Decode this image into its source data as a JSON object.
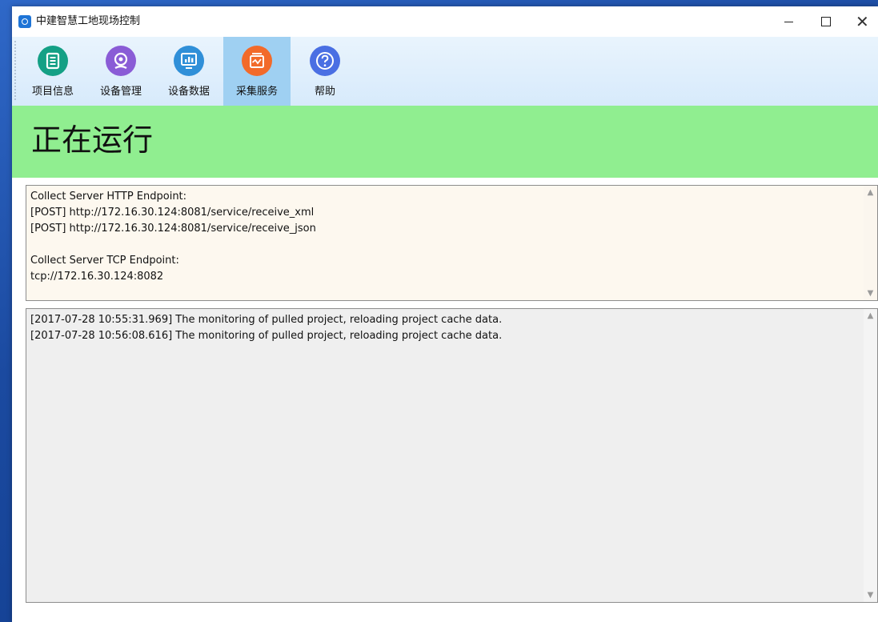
{
  "window": {
    "title": "中建智慧工地现场控制",
    "controls": {
      "minimize": "minimize-icon",
      "maximize": "maximize-icon",
      "close": "close-icon"
    }
  },
  "toolbar": {
    "items": [
      {
        "label": "项目信息",
        "icon": "document-icon",
        "color": "#14a085",
        "active": false
      },
      {
        "label": "设备管理",
        "icon": "webcam-icon",
        "color": "#8a5cd6",
        "active": false
      },
      {
        "label": "设备数据",
        "icon": "monitor-chart-icon",
        "color": "#2f8fd8",
        "active": false
      },
      {
        "label": "采集服务",
        "icon": "collection-service-icon",
        "color": "#f26a2a",
        "active": true
      },
      {
        "label": "帮助",
        "icon": "help-icon",
        "color": "#4a6fe3",
        "active": false
      }
    ]
  },
  "status": {
    "text": "正在运行",
    "color": "#90ee90"
  },
  "endpoints": {
    "lines": [
      "Collect Server HTTP Endpoint:",
      "[POST] http://172.16.30.124:8081/service/receive_xml",
      "[POST] http://172.16.30.124:8081/service/receive_json",
      "",
      "Collect Server TCP Endpoint:",
      "tcp://172.16.30.124:8082"
    ]
  },
  "log": {
    "lines": [
      "[2017-07-28 10:55:31.969] The monitoring of pulled project, reloading project cache data.",
      "[2017-07-28 10:56:08.616] The monitoring of pulled project, reloading project cache data."
    ]
  }
}
